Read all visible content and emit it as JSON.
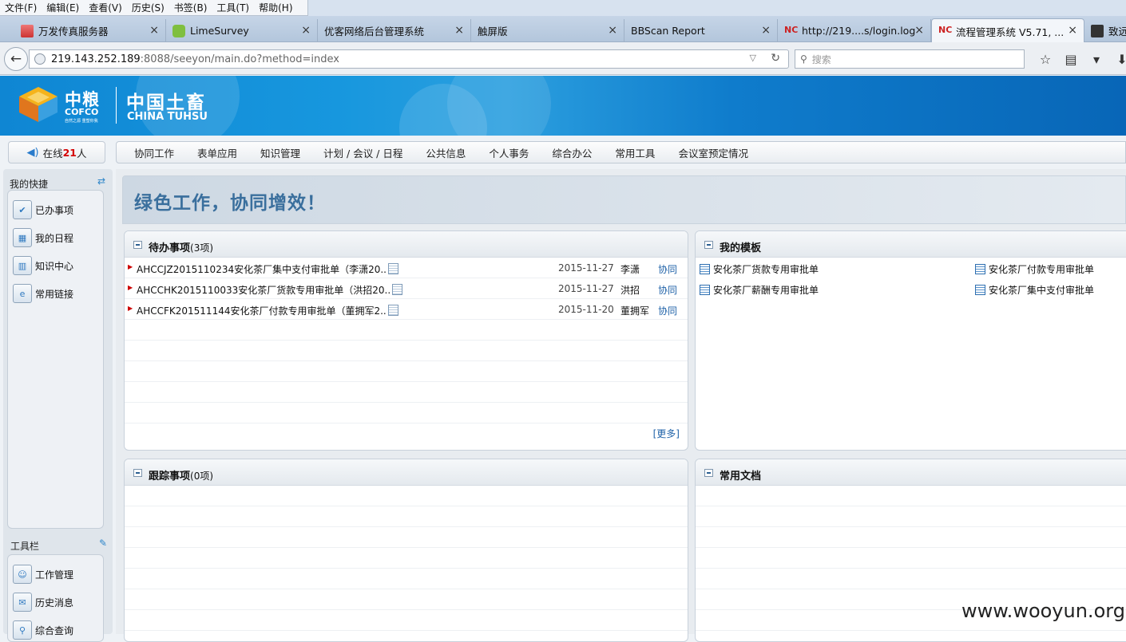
{
  "menu": [
    "文件(F)",
    "编辑(E)",
    "查看(V)",
    "历史(S)",
    "书签(B)",
    "工具(T)",
    "帮助(H)"
  ],
  "tabs": [
    {
      "label": "万发传真服务器",
      "close": "×"
    },
    {
      "label": "LimeSurvey",
      "close": "×"
    },
    {
      "label": "优客网络后台管理系统",
      "close": "×"
    },
    {
      "label": "触屏版",
      "close": "×"
    },
    {
      "label": "BBScan Report",
      "close": "×"
    },
    {
      "label": "http://219....s/login.log",
      "close": "×"
    },
    {
      "label": "流程管理系统 V5.71, ...",
      "close": "×"
    },
    {
      "label": "致远"
    }
  ],
  "address": {
    "host": "219.143.252.189",
    "path": ":8088/seeyon/main.do?method=index"
  },
  "search": {
    "placeholder": "搜索"
  },
  "banner": {
    "logo_cn": "中粮",
    "logo_en": "COFCO",
    "logo_slogan": "自然之源 重塑你我",
    "brand_cn": "中国土畜",
    "brand_en": "CHINA TUHSU"
  },
  "online": {
    "prefix": "在线 ",
    "count": "21",
    "suffix": "人"
  },
  "topnav": [
    "协同工作",
    "表单应用",
    "知识管理",
    "计划 / 会议 / 日程",
    "公共信息",
    "个人事务",
    "综合办公",
    "常用工具",
    "会议室预定情况"
  ],
  "sidebar": {
    "shortcuts_title": "我的快捷",
    "shortcuts": [
      "已办事项",
      "我的日程",
      "知识中心",
      "常用链接"
    ],
    "toolbar_title": "工具栏",
    "tools": [
      "工作管理",
      "历史消息",
      "综合查询"
    ]
  },
  "welcome": "绿色工作，协同增效！",
  "pending": {
    "title": "待办事项",
    "count": "(3项)",
    "rows": [
      {
        "subject": "AHCCJZ2015110234安化茶厂集中支付审批单（李潇20..",
        "date": "2015-11-27",
        "sender": "李潇",
        "type": "协同"
      },
      {
        "subject": "AHCCHK2015110033安化茶厂货款专用审批单（洪招20..",
        "date": "2015-11-27",
        "sender": "洪招",
        "type": "协同"
      },
      {
        "subject": "AHCCFK201511144安化茶厂付款专用审批单（董拥军2..",
        "date": "2015-11-20",
        "sender": "董拥军",
        "type": "协同"
      }
    ],
    "more": "[更多]"
  },
  "templates": {
    "title": "我的模板",
    "items": [
      "安化茶厂货款专用审批单",
      "安化茶厂付款专用审批单",
      "安化茶厂薪酬专用审批单",
      "安化茶厂集中支付审批单"
    ]
  },
  "tracking": {
    "title": "跟踪事项",
    "count": "(0项)"
  },
  "docs": {
    "title": "常用文档"
  },
  "watermark": "www.wooyun.org"
}
